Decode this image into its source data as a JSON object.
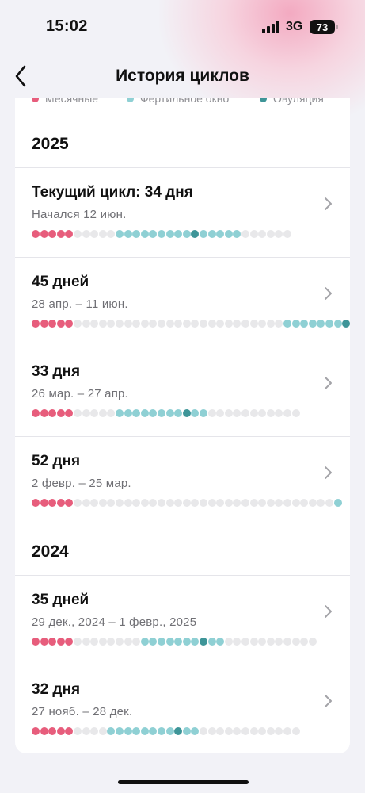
{
  "status_bar": {
    "time": "15:02",
    "network": "3G",
    "battery": "73"
  },
  "nav": {
    "title": "История циклов"
  },
  "legend": [
    {
      "label": "Месячные",
      "color": "#e75d7c"
    },
    {
      "label": "Фертильное окно",
      "color": "#8fd0d4"
    },
    {
      "label": "Овуляция",
      "color": "#3e9598"
    }
  ],
  "colors": {
    "period": "#e75d7c",
    "fertile": "#8fd0d4",
    "ovulation": "#3e9598",
    "empty": "#e8e8ea"
  },
  "sections": [
    {
      "year": "2025",
      "cycles": [
        {
          "title": "Текущий цикл: 34 дня",
          "subtitle": "Начался 12 июн.",
          "days": "PPPPPEEEEEFFFFFFFFFOFFFFFEEEEEE"
        },
        {
          "title": "45 дней",
          "subtitle": "28 апр. – 11 июн.",
          "days": "PPPPPEEEEEEEEEEEEEEEEEEEEEEEEEFFFFFFFO"
        },
        {
          "title": "33 дня",
          "subtitle": "26 мар. – 27 апр.",
          "days": "PPPPPEEEEEFFFFFFFFOFFEEEEEEEEEEE"
        },
        {
          "title": "52 дня",
          "subtitle": "2 февр. – 25 мар.",
          "days": "PPPPPEEEEEEEEEEEEEEEEEEEEEEEEEEEEEEEF"
        }
      ]
    },
    {
      "year": "2024",
      "cycles": [
        {
          "title": "35 дней",
          "subtitle": "29 дек., 2024 – 1 февр., 2025",
          "days": "PPPPPEEEEEEEEFFFFFFFOFFEEEEEEEEEEE"
        },
        {
          "title": "32 дня",
          "subtitle": "27 нояб. – 28 дек.",
          "days": "PPPPPEEEEFFFFFFFFOFFEEEEEEEEEEEE"
        }
      ]
    }
  ]
}
